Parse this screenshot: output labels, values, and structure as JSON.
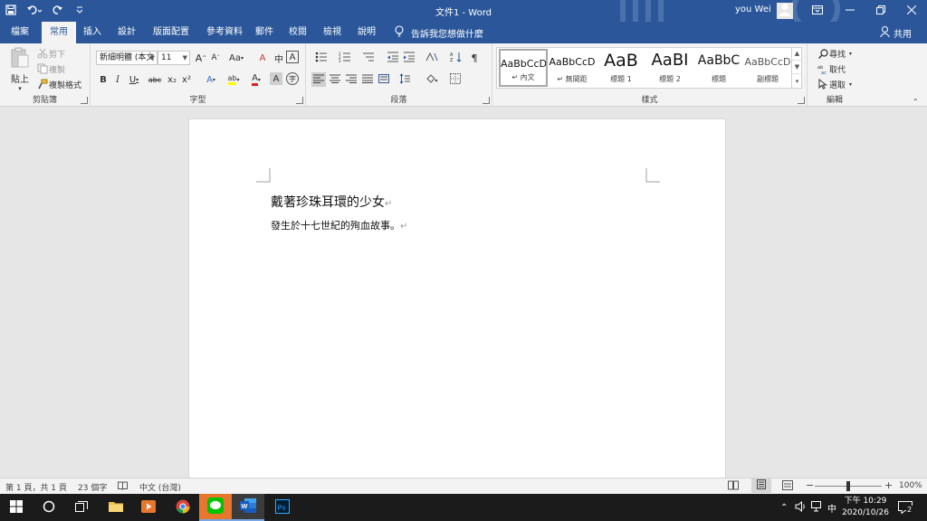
{
  "window": {
    "title": "文件1  -  Word",
    "user_name": "you Wei"
  },
  "tabs": [
    "檔案",
    "常用",
    "插入",
    "設計",
    "版面配置",
    "參考資料",
    "郵件",
    "校閱",
    "檢視",
    "說明"
  ],
  "active_tab": "常用",
  "tell_me": "告訴我您想做什麼",
  "share": "共用",
  "ribbon": {
    "clipboard": {
      "paste": "貼上",
      "cut": "剪下",
      "copy": "複製",
      "format_painter": "複製格式",
      "group_label": "剪貼簿"
    },
    "font": {
      "font_name": "新細明體 (本文",
      "font_size": "11",
      "grow": "A",
      "shrink": "A",
      "case": "Aa",
      "clear": "A",
      "phonetic": "中",
      "border_char": "A",
      "bold": "B",
      "italic": "I",
      "underline": "U",
      "strike": "abc",
      "subscript": "x₂",
      "superscript": "x²",
      "effects": "A",
      "highlight": "ab",
      "font_color": "A",
      "shading": "A",
      "enclose": "字",
      "group_label": "字型"
    },
    "paragraph": {
      "group_label": "段落"
    },
    "styles": {
      "items": [
        {
          "preview": "AaBbCcD",
          "name": "↵ 內文"
        },
        {
          "preview": "AaBbCcD",
          "name": "↵ 無間距"
        },
        {
          "preview": "AaB",
          "name": "標題 1"
        },
        {
          "preview": "AaBI",
          "name": "標題 2"
        },
        {
          "preview": "AaBbC",
          "name": "標題"
        },
        {
          "preview": "AaBbCcD",
          "name": "副標題"
        }
      ],
      "group_label": "樣式"
    },
    "editing": {
      "find": "尋找",
      "replace": "取代",
      "select": "選取",
      "group_label": "編輯"
    }
  },
  "document": {
    "paragraphs": [
      {
        "text": "戴著珍珠耳環的少女",
        "mark": "↵"
      },
      {
        "text": "發生於十七世紀的殉血故事。",
        "mark": "↵"
      }
    ]
  },
  "status": {
    "page": "第 1 頁，共 1 頁",
    "words": "23 個字",
    "language": "中文 (台灣)",
    "zoom": "100%",
    "zoom_minus": "−",
    "zoom_plus": "+"
  },
  "taskbar": {
    "ime": "中",
    "time": "下午 10:29",
    "date": "2020/10/26",
    "notification_count": "2"
  },
  "colors": {
    "word_blue": "#2b579a",
    "ribbon_bg": "#f3f3f3",
    "doc_bg": "#e6e6e6",
    "taskbar_bg": "#1b1b1b"
  }
}
